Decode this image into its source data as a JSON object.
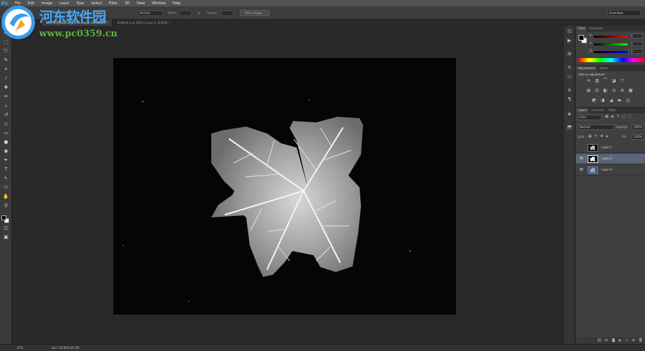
{
  "menubar": {
    "app_logo": "Ps",
    "items": [
      "File",
      "Edit",
      "Image",
      "Layer",
      "Type",
      "Select",
      "Filter",
      "3D",
      "View",
      "Window",
      "Help"
    ]
  },
  "options": {
    "style_value": "Normal",
    "width_label": "Width:",
    "height_label": "Height:",
    "refine_edge": "Refine Edge...",
    "workspace": "Essentials"
  },
  "tabs": [
    {
      "label": "2016052023...",
      "active": false
    },
    {
      "label": "DPP095_1258.tif @ 25% (Layer 2, RGB/8*) *",
      "active": true
    },
    {
      "label": "Untitled-2 @ 100% (Layer 2, RGB/8) *",
      "active": false
    }
  ],
  "status": {
    "zoom": "25%",
    "doc": "Doc: 59.8M/136.3M"
  },
  "color_panel": {
    "tabs": [
      "Color",
      "Swatches"
    ],
    "channels": [
      {
        "label": "R",
        "value": "0",
        "gradient": "linear-gradient(to right,#000,#f00)"
      },
      {
        "label": "G",
        "value": "0",
        "gradient": "linear-gradient(to right,#000,#0f0)"
      },
      {
        "label": "B",
        "value": "0",
        "gradient": "linear-gradient(to right,#000,#00f)"
      }
    ]
  },
  "adjustments_panel": {
    "tabs": [
      "Adjustments",
      "Styles"
    ],
    "title": "Add an adjustment"
  },
  "layers_panel": {
    "tabs": [
      "Layers",
      "Channels",
      "Paths"
    ],
    "kind_filter": "Kind",
    "blend_mode": "Normal",
    "opacity_label": "Opacity:",
    "opacity_value": "100%",
    "lock_label": "Lock:",
    "fill_label": "Fill:",
    "fill_value": "100%",
    "layers": [
      {
        "name": "Layer 1",
        "visible": false,
        "selected": false
      },
      {
        "name": "Layer 2",
        "visible": true,
        "selected": true
      },
      {
        "name": "Layer 0",
        "visible": true,
        "selected": false
      }
    ]
  },
  "watermark": {
    "title": "河东软件园",
    "url": "www.pc0359.cn"
  },
  "colors": {
    "selected_layer": "#596678",
    "ps_blue": "#3da8f5"
  }
}
